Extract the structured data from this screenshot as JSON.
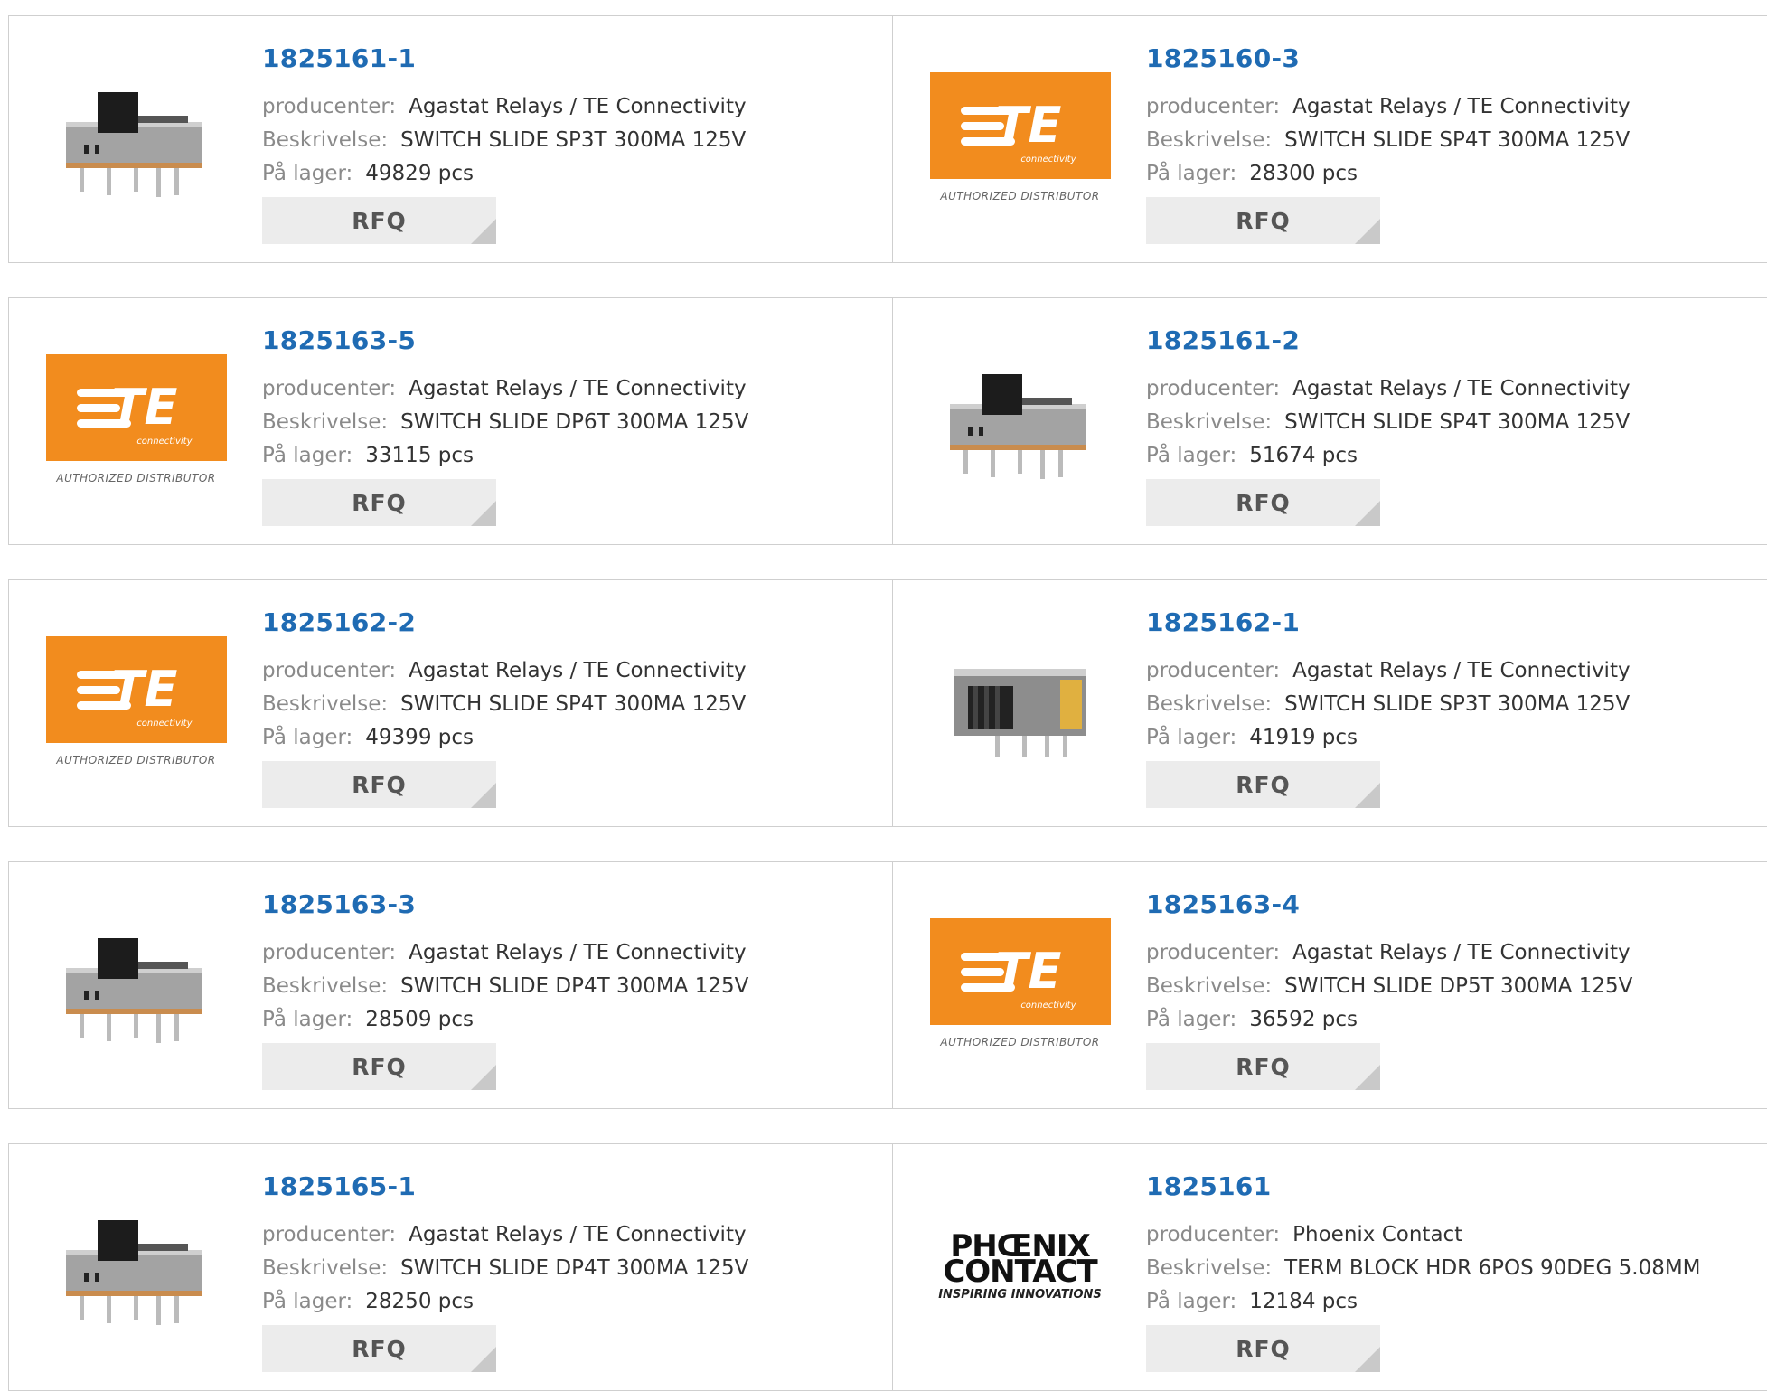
{
  "labels": {
    "manufacturer": "producenter:",
    "description": "Beskrivelse:",
    "stock": "På lager:",
    "rfq": "RFQ"
  },
  "brand": {
    "te_text": "TE",
    "te_sub": "connectivity",
    "te_caption": "AUTHORIZED DISTRIBUTOR",
    "phoenix_word": "PHŒNIX CONTACT",
    "phoenix_tag": "INSPIRING INNOVATIONS"
  },
  "colors": {
    "link": "#1f6bb3",
    "te_orange": "#f28c1e",
    "rfq_bg": "#ececec"
  },
  "products": [
    {
      "pn": "1825161-1",
      "manufacturer": "Agastat Relays / TE Connectivity",
      "description": "SWITCH SLIDE SP3T 300MA 125V",
      "stock": "49829 pcs",
      "image": "slide-switch-photo"
    },
    {
      "pn": "1825160-3",
      "manufacturer": "Agastat Relays / TE Connectivity",
      "description": "SWITCH SLIDE SP4T 300MA 125V",
      "stock": "28300 pcs",
      "image": "te-logo"
    },
    {
      "pn": "1825163-5",
      "manufacturer": "Agastat Relays / TE Connectivity",
      "description": "SWITCH SLIDE DP6T 300MA 125V",
      "stock": "33115 pcs",
      "image": "te-logo"
    },
    {
      "pn": "1825161-2",
      "manufacturer": "Agastat Relays / TE Connectivity",
      "description": "SWITCH SLIDE SP4T 300MA 125V",
      "stock": "51674 pcs",
      "image": "slide-switch-photo"
    },
    {
      "pn": "1825162-2",
      "manufacturer": "Agastat Relays / TE Connectivity",
      "description": "SWITCH SLIDE SP4T 300MA 125V",
      "stock": "49399 pcs",
      "image": "te-logo"
    },
    {
      "pn": "1825162-1",
      "manufacturer": "Agastat Relays / TE Connectivity",
      "description": "SWITCH SLIDE SP3T 300MA 125V",
      "stock": "41919 pcs",
      "image": "slide-switch-photo-alt"
    },
    {
      "pn": "1825163-3",
      "manufacturer": "Agastat Relays / TE Connectivity",
      "description": "SWITCH SLIDE DP4T 300MA 125V",
      "stock": "28509 pcs",
      "image": "slide-switch-photo"
    },
    {
      "pn": "1825163-4",
      "manufacturer": "Agastat Relays / TE Connectivity",
      "description": "SWITCH SLIDE DP5T 300MA 125V",
      "stock": "36592 pcs",
      "image": "te-logo"
    },
    {
      "pn": "1825165-1",
      "manufacturer": "Agastat Relays / TE Connectivity",
      "description": "SWITCH SLIDE DP4T 300MA 125V",
      "stock": "28250 pcs",
      "image": "slide-switch-photo"
    },
    {
      "pn": "1825161",
      "manufacturer": "Phoenix Contact",
      "description": "TERM BLOCK HDR 6POS 90DEG 5.08MM",
      "stock": "12184 pcs",
      "image": "phoenix-logo"
    }
  ]
}
